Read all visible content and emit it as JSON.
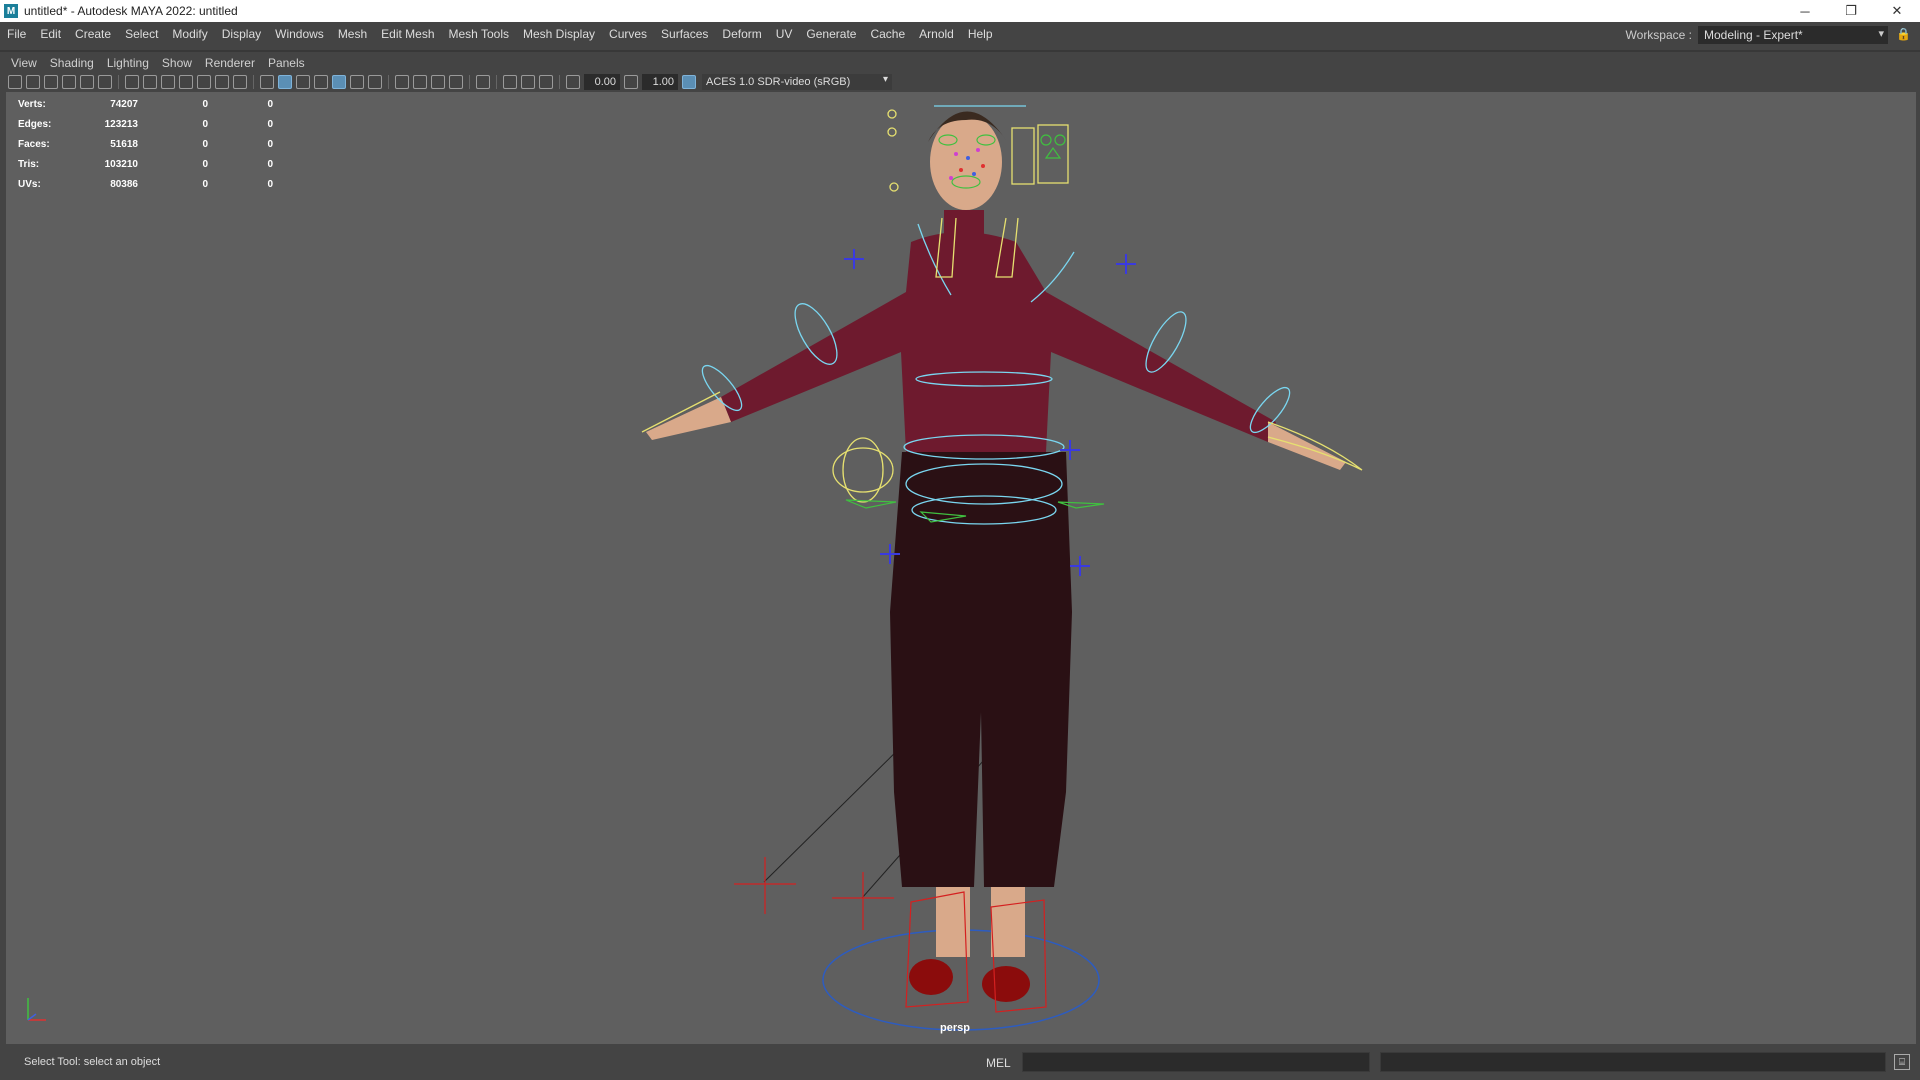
{
  "window": {
    "title": "untitled* - Autodesk MAYA 2022: untitled",
    "app_icon": "M",
    "controls": {
      "minimize": "─",
      "restore": "❐",
      "close": "✕"
    }
  },
  "menubar": {
    "items": [
      "File",
      "Edit",
      "Create",
      "Select",
      "Modify",
      "Display",
      "Windows",
      "Mesh",
      "Edit Mesh",
      "Mesh Tools",
      "Mesh Display",
      "Curves",
      "Surfaces",
      "Deform",
      "UV",
      "Generate",
      "Cache",
      "Arnold",
      "Help"
    ]
  },
  "workspace": {
    "label": "Workspace :",
    "value": "Modeling - Expert*",
    "arrow": "▾",
    "lock": "🔒"
  },
  "panel_menu": {
    "items": [
      "View",
      "Shading",
      "Lighting",
      "Show",
      "Renderer",
      "Panels"
    ]
  },
  "panel_toolbar": {
    "exposure": "0.00",
    "gamma": "1.00",
    "color_space": "ACES 1.0 SDR-video (sRGB)",
    "dropdown_arrow": "▾"
  },
  "hud": {
    "rows": [
      {
        "label": "Verts:",
        "v1": "74207",
        "v2": "0",
        "v3": "0"
      },
      {
        "label": "Edges:",
        "v1": "123213",
        "v2": "0",
        "v3": "0"
      },
      {
        "label": "Faces:",
        "v1": "51618",
        "v2": "0",
        "v3": "0"
      },
      {
        "label": "Tris:",
        "v1": "103210",
        "v2": "0",
        "v3": "0"
      },
      {
        "label": "UVs:",
        "v1": "80386",
        "v2": "0",
        "v3": "0"
      }
    ]
  },
  "viewport": {
    "camera": "persp",
    "sweater_color": "#6e1a2e",
    "pants_color": "#2a1014",
    "skin_color": "#d9a98a",
    "shoe_color": "#8b0c0c",
    "control_cyan": "#7ad6f0",
    "control_yellow": "#e6e070",
    "control_blue": "#3a3ae0",
    "control_red": "#d42020"
  },
  "status": {
    "help_line": "Select Tool: select an object",
    "mel_label": "MEL"
  }
}
